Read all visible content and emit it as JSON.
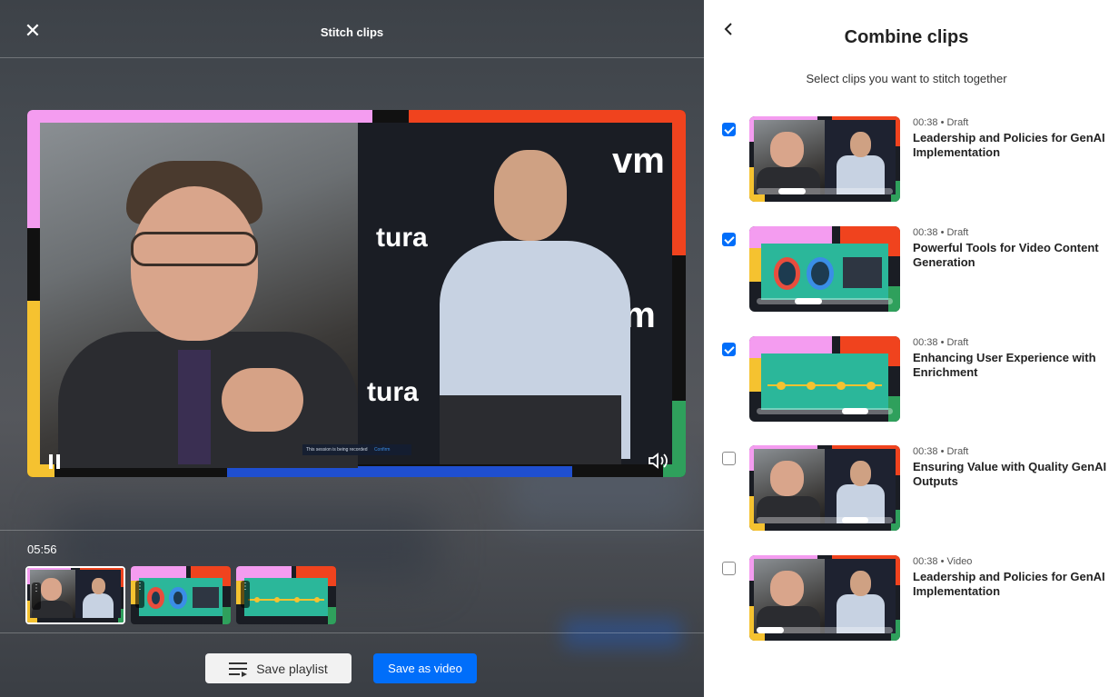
{
  "editor": {
    "title": "Stitch clips",
    "time": "05:56",
    "save_playlist_label": "Save playlist",
    "save_video_label": "Save as video",
    "player_banner_text": "This session is being recorded",
    "player_banner_button": "Confirm",
    "timeline_clips": [
      {
        "art": "speakers",
        "selected": true
      },
      {
        "art": "slide-donut",
        "selected": false
      },
      {
        "art": "slide-timeline",
        "selected": false
      }
    ]
  },
  "panel": {
    "title": "Combine clips",
    "subtitle": "Select clips you want to stitch together",
    "clips": [
      {
        "status": "00:38 • Draft",
        "name": "Leadership and Policies for GenAI Implementation",
        "checked": true,
        "art": "speakers",
        "scrub": 0.2
      },
      {
        "status": "00:38 • Draft",
        "name": "Powerful Tools for Video Content Generation",
        "checked": true,
        "art": "slide-donut",
        "scrub": 0.35
      },
      {
        "status": "00:38 • Draft",
        "name": "Enhancing User Experience with Enrichment",
        "checked": true,
        "art": "slide-timeline",
        "scrub": 0.78
      },
      {
        "status": "00:38 • Draft",
        "name": "Ensuring Value with Quality GenAI Outputs",
        "checked": false,
        "art": "speakers",
        "scrub": 0.78
      },
      {
        "status": "00:38 • Video",
        "name": "Leadership and Policies for GenAI Implementation",
        "checked": false,
        "art": "speakers",
        "scrub": 0
      }
    ]
  },
  "colors": {
    "accent": "#006efa",
    "brand_pink": "#f49cf0",
    "brand_red": "#f0431e",
    "brand_yellow": "#f5c230",
    "brand_green": "#2fa05c"
  },
  "icons": {
    "close": "close-icon",
    "back": "chevron-left-icon",
    "pause": "pause-icon",
    "volume": "volume-icon",
    "playlist": "playlist-icon",
    "drag": "drag-handle-icon"
  }
}
